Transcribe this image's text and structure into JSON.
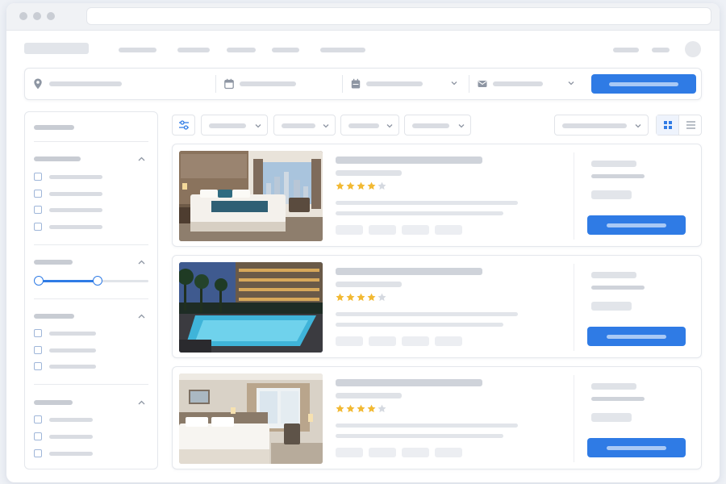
{
  "window": {
    "controls": [
      "window-dot-close",
      "window-dot-minimize",
      "window-dot-maximize"
    ]
  },
  "nav": {
    "items": [
      "nav-item-1",
      "nav-item-2",
      "nav-item-3",
      "nav-item-4",
      "nav-item-5"
    ]
  },
  "search": {
    "fields": [
      {
        "name": "location-field",
        "icon": "map-pin-icon"
      },
      {
        "name": "date-field",
        "icon": "calendar-icon"
      },
      {
        "name": "checkout-date-field",
        "icon": "calendar-icon"
      },
      {
        "name": "guests-field",
        "icon": "envelope-icon"
      }
    ]
  },
  "filters": {
    "groups": [
      {
        "kind": "checkbox",
        "options": 4
      },
      {
        "kind": "range-slider",
        "low": 0.0,
        "high": 0.54
      },
      {
        "kind": "checkbox",
        "options": 3
      },
      {
        "kind": "checkbox",
        "options": 3
      }
    ]
  },
  "toolbar": {
    "filter_chips": 4,
    "view_mode": "grid"
  },
  "listings": [
    {
      "image": "hotel-room-city-view",
      "rating": 4,
      "rating_max": 5
    },
    {
      "image": "hotel-pool-night",
      "rating": 4,
      "rating_max": 5
    },
    {
      "image": "hotel-room-bright",
      "rating": 4,
      "rating_max": 5
    }
  ],
  "colors": {
    "accent": "#2f7be5",
    "star_filled": "#f2b933",
    "star_empty": "#d5d9e0",
    "placeholder": "#dfe2e8"
  }
}
